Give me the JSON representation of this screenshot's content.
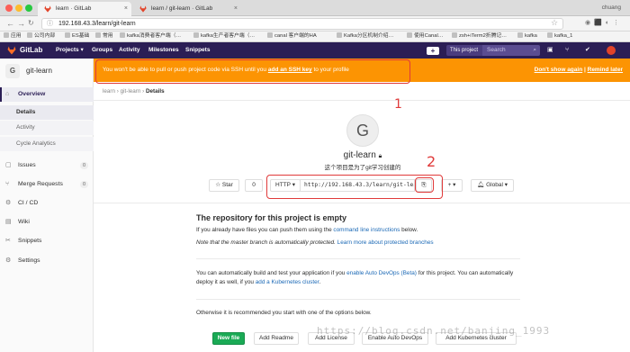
{
  "browser": {
    "tabs": [
      {
        "title": "learn · GitLab",
        "active": true
      },
      {
        "title": "learn / git-learn · GitLab",
        "active": false
      }
    ],
    "user": "chuang",
    "url": "192.168.43.3/learn/git-learn",
    "bookmarks": [
      "应用",
      "公司内部",
      "ES基础",
      "常用",
      "kafka消费者客户端（…",
      "kafka生产者客户端（…",
      "canal 客户端的HA",
      "Kafka分区机制介绍…",
      "使用Canal…",
      "zsh+iTerm2折腾记…",
      "kafka",
      "kafka_1"
    ]
  },
  "gitlab_nav": {
    "brand": "GitLab",
    "links": [
      "Projects ▾",
      "Groups",
      "Activity",
      "Milestones",
      "Snippets"
    ],
    "scope": "This project",
    "search_placeholder": "Search",
    "plus": "+"
  },
  "sidebar": {
    "project_initial": "G",
    "project_name": "git-learn",
    "overview": "Overview",
    "sub_items": [
      "Details",
      "Activity",
      "Cycle Analytics"
    ],
    "items": [
      {
        "label": "Issues",
        "count": "0"
      },
      {
        "label": "Merge Requests",
        "count": "0"
      },
      {
        "label": "CI / CD",
        "count": ""
      },
      {
        "label": "Wiki",
        "count": ""
      },
      {
        "label": "Snippets",
        "count": ""
      },
      {
        "label": "Settings",
        "count": ""
      }
    ]
  },
  "banner": {
    "message": "You won't be able to pull or push project code via SSH until you",
    "link": "add an SSH key",
    "suffix": "to your profile",
    "dont_show": "Don't show again",
    "sep": "|",
    "remind": "Remind later",
    "color": "#fc9403"
  },
  "breadcrumb": {
    "a": "learn",
    "b": "git-learn",
    "c": "Details",
    "sep": "›"
  },
  "project": {
    "initial": "G",
    "title": "git-learn",
    "description": "这个项目是为了git学习创建的",
    "star_label": "Star",
    "star_count": "0",
    "protocol": "HTTP",
    "clone_url": "http://192.168.43.3/learn/git-learn.git",
    "visibility": "Global"
  },
  "empty_repo": {
    "heading": "The repository for this project is empty",
    "p1_pre": "If you already have files you can push them using the",
    "p1_link": "command line instructions",
    "p1_post": "below.",
    "p2_italic": "Note that the master branch is automatically protected.",
    "p2_link": "Learn more about protected branches",
    "p3_pre": "You can automatically build and test your application if you",
    "p3_link": "enable Auto DevOps (Beta)",
    "p3_mid": "for this project. You can automatically deploy it as well, if you",
    "p3_link2": "add a Kubernetes cluster",
    "p3_post": ".",
    "p4": "Otherwise it is recommended you start with one of the options below.",
    "buttons": [
      "New file",
      "Add Readme",
      "Add License",
      "Enable Auto DevOps",
      "Add Kubernetes cluster"
    ]
  },
  "annotations": [
    "1",
    "2"
  ],
  "watermark": "https://blog.csdn.net/banjing_1993",
  "colors": {
    "nav": "#2b1e55",
    "accent": "#1aaa55",
    "link": "#1b69b6",
    "annotation": "#e03a3a"
  }
}
